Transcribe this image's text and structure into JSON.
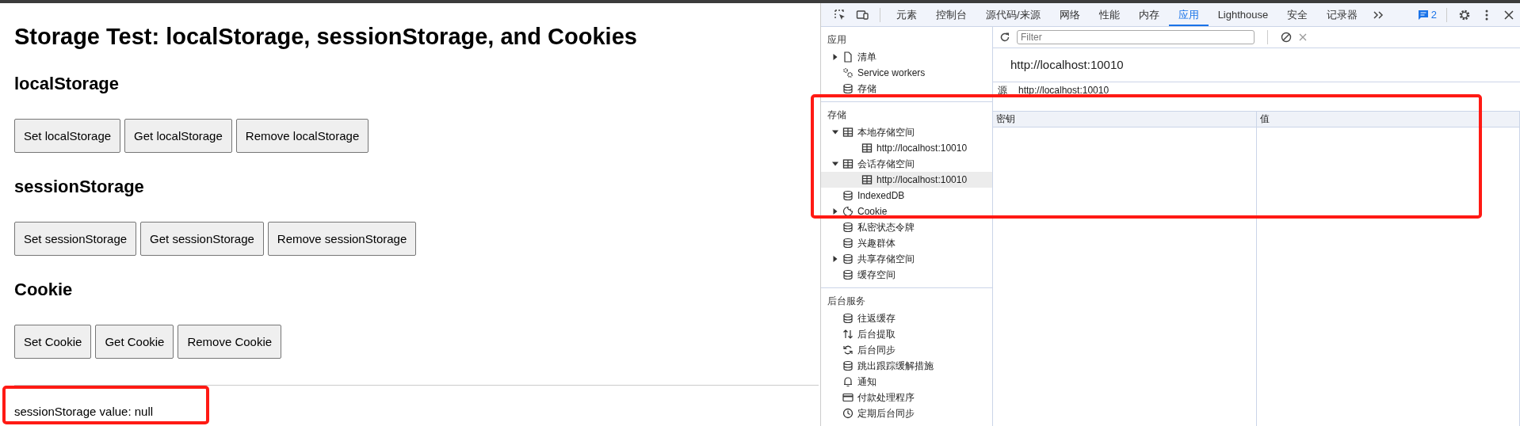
{
  "page": {
    "title": "Storage Test: localStorage, sessionStorage, and Cookies",
    "sections": [
      {
        "heading": "localStorage",
        "buttons": [
          "Set localStorage",
          "Get localStorage",
          "Remove localStorage"
        ]
      },
      {
        "heading": "sessionStorage",
        "buttons": [
          "Set sessionStorage",
          "Get sessionStorage",
          "Remove sessionStorage"
        ]
      },
      {
        "heading": "Cookie",
        "buttons": [
          "Set Cookie",
          "Get Cookie",
          "Remove Cookie"
        ]
      }
    ],
    "result": "sessionStorage value: null"
  },
  "devtools": {
    "tabs": [
      {
        "label": "元素",
        "selected": false
      },
      {
        "label": "控制台",
        "selected": false
      },
      {
        "label": "源代码/来源",
        "selected": false
      },
      {
        "label": "网络",
        "selected": false
      },
      {
        "label": "性能",
        "selected": false
      },
      {
        "label": "内存",
        "selected": false
      },
      {
        "label": "应用",
        "selected": true
      },
      {
        "label": "Lighthouse",
        "selected": false
      },
      {
        "label": "安全",
        "selected": false
      },
      {
        "label": "记录器",
        "selected": false
      }
    ],
    "issues_count": "2",
    "sidebar": [
      {
        "heading": "应用",
        "items": [
          {
            "label": "清单",
            "kind": "file",
            "expanded": false,
            "selected": false
          },
          {
            "label": "Service workers",
            "kind": "gears",
            "selected": false
          },
          {
            "label": "存储",
            "kind": "database",
            "selected": false
          }
        ]
      },
      {
        "heading": "存储",
        "items": [
          {
            "label": "本地存储空间",
            "kind": "table",
            "expanded": true,
            "selected": false,
            "children": [
              {
                "label": "http://localhost:10010",
                "kind": "table",
                "selected": false
              }
            ]
          },
          {
            "label": "会话存储空间",
            "kind": "table",
            "expanded": true,
            "selected": false,
            "children": [
              {
                "label": "http://localhost:10010",
                "kind": "table",
                "selected": true
              }
            ]
          },
          {
            "label": "IndexedDB",
            "kind": "database",
            "selected": false
          },
          {
            "label": "Cookie",
            "kind": "cookie",
            "expanded": false,
            "selected": false
          },
          {
            "label": "私密状态令牌",
            "kind": "database",
            "selected": false
          },
          {
            "label": "兴趣群体",
            "kind": "database",
            "selected": false
          },
          {
            "label": "共享存储空间",
            "kind": "database",
            "expanded": false,
            "selected": false
          },
          {
            "label": "缓存空间",
            "kind": "database",
            "selected": false
          }
        ]
      },
      {
        "heading": "后台服务",
        "items": [
          {
            "label": "往返缓存",
            "kind": "database",
            "selected": false
          },
          {
            "label": "后台提取",
            "kind": "transfer",
            "selected": false
          },
          {
            "label": "后台同步",
            "kind": "sync",
            "selected": false
          },
          {
            "label": "跳出跟踪缓解措施",
            "kind": "database",
            "selected": false
          },
          {
            "label": "通知",
            "kind": "bell",
            "selected": false
          },
          {
            "label": "付款处理程序",
            "kind": "card",
            "selected": false
          },
          {
            "label": "定期后台同步",
            "kind": "clock",
            "selected": false
          }
        ]
      }
    ],
    "filter": {
      "placeholder": "Filter"
    },
    "origin_title": "http://localhost:10010",
    "origin_label": "源",
    "origin_value": "http://localhost:10010",
    "columns": [
      "密钥",
      "值"
    ]
  }
}
